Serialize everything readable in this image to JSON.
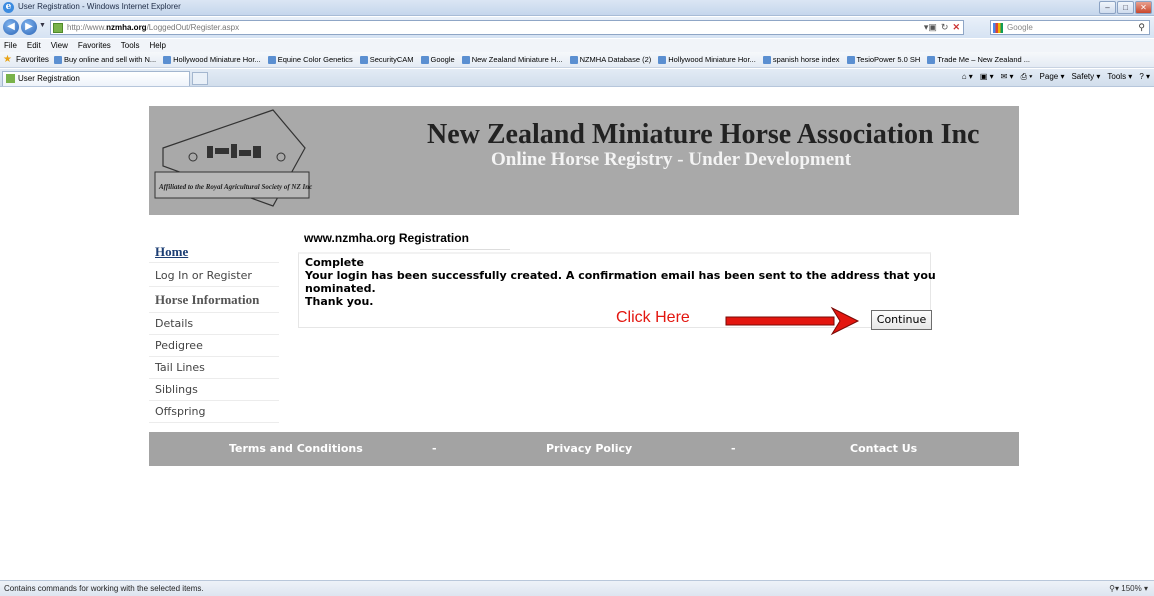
{
  "browser": {
    "window_title": "User Registration - Windows Internet Explorer",
    "url_prefix": "http://www.",
    "url_domain": "nzmha.org",
    "url_path": "/LoggedOut/Register.aspx",
    "search_placeholder": "Google",
    "menu": [
      "File",
      "Edit",
      "View",
      "Favorites",
      "Tools",
      "Help"
    ],
    "favorites_label": "Favorites",
    "favorites_links": [
      "Buy online and sell with N...",
      "Hollywood Miniature Hor...",
      "Equine Color Genetics",
      "SecurityCAM",
      "Google",
      "New Zealand Miniature H...",
      "NZMHA Database (2)",
      "Hollywood Miniature Hor...",
      "spanish horse index",
      "TesioPower 5.0 SH",
      "Trade Me – New Zealand ..."
    ],
    "tab_title": "User Registration",
    "command_bar": [
      "Page ▾",
      "Safety ▾",
      "Tools ▾"
    ],
    "status_text": "Contains commands for working with the selected items.",
    "zoom": "150%"
  },
  "header": {
    "title": "New Zealand Miniature Horse Association Inc",
    "subtitle": "Online Horse Registry - Under Development",
    "logo_caption": "Affiliated to the Royal Agricultural Society of NZ Inc"
  },
  "sidebar": {
    "home": "Home",
    "login": "Log In or Register",
    "horse_info_heading": "Horse Information",
    "items": [
      "Details",
      "Pedigree",
      "Tail Lines",
      "Siblings",
      "Offspring"
    ]
  },
  "main": {
    "page_title": "www.nzmha.org Registration",
    "status_title": "Complete",
    "message": "Your login has been successfully created. A confirmation email has been sent to the address that you nominated.",
    "thanks": "Thank you.",
    "annotation": "Click Here",
    "continue_label": "Continue"
  },
  "footer": {
    "terms": "Terms and Conditions",
    "privacy": "Privacy Policy",
    "contact": "Contact Us",
    "separator": "-"
  },
  "colors": {
    "header_bg": "#a9a9a9",
    "footer_bg": "#a3a3a3",
    "annotation_red": "#e3160f",
    "home_link": "#1b3d73"
  }
}
